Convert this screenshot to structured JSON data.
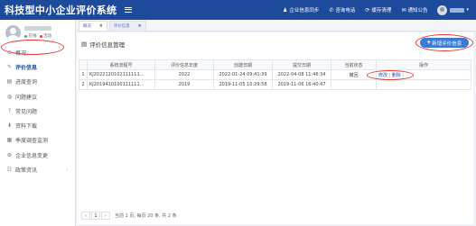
{
  "header": {
    "title": "科技型中小企业评价系统",
    "links": [
      {
        "icon": "user-icon",
        "glyph": "♟",
        "label": "企业信息同步"
      },
      {
        "icon": "phone-icon",
        "glyph": "✆",
        "label": "咨询电话"
      },
      {
        "icon": "refresh-icon",
        "glyph": "⟳",
        "label": "缓存清理"
      },
      {
        "icon": "mail-icon",
        "glyph": "✉",
        "label": "通知公告"
      }
    ],
    "caret": "▾"
  },
  "profile": {
    "online_label": "在线",
    "status_label": "活动",
    "online_color": "#4caf50",
    "status_color": "#e53935"
  },
  "sidebar": {
    "items": [
      {
        "label": "概况",
        "glyph": "⊙",
        "icon": "overview-icon"
      },
      {
        "label": "评价信息",
        "glyph": "✎",
        "icon": "edit-icon",
        "active": true
      },
      {
        "label": "进度查询",
        "glyph": "▤",
        "icon": "progress-icon"
      },
      {
        "label": "问题建议",
        "glyph": "◍",
        "icon": "suggestion-icon"
      },
      {
        "label": "常见问题",
        "glyph": "?",
        "icon": "question-icon"
      },
      {
        "label": "资料下载",
        "glyph": "⬇",
        "icon": "download-icon"
      },
      {
        "label": "季度调查监测",
        "glyph": "▦",
        "icon": "survey-icon"
      },
      {
        "label": "企业信息变更",
        "glyph": "⚙",
        "icon": "settings-icon"
      },
      {
        "label": "政策资讯",
        "glyph": "☷",
        "icon": "news-icon",
        "has_arrow": true
      }
    ],
    "arrow": "‹"
  },
  "tabs": [
    {
      "label": "概况",
      "close": "✖"
    },
    {
      "label": "评价信息",
      "close": "✖",
      "active": true
    }
  ],
  "panel": {
    "icon_glyph": "▤",
    "title": "评价信息管理",
    "new_button": {
      "plus": "+",
      "label": "新增评价信息"
    }
  },
  "table": {
    "headers": [
      "",
      "系统流程号",
      "评价信息年度",
      "创建日期",
      "提交日期",
      "当前状态",
      "操作"
    ],
    "rows": [
      {
        "index": "1",
        "flow_no": "KJ2022120102111111...",
        "year": "2022",
        "created": "2022-01-24 09:41:39",
        "submitted": "2022-04-08 11:46:34",
        "status": "撤回",
        "op_edit": "修改",
        "op_sep": "|",
        "op_delete": "删除",
        "op_sep2": "|"
      },
      {
        "index": "2",
        "flow_no": "KJ2019410100111111...",
        "year": "2019",
        "created": "2019-11-05 10:29:58",
        "submitted": "2019-11-06 16:40:47",
        "status": "",
        "op_edit": "",
        "op_sep": "",
        "op_delete": "",
        "op_sep2": ""
      }
    ]
  },
  "pager": {
    "prev": "‹",
    "current": "1",
    "next": "›",
    "info": "当前 1 页, 每页 20 条, 共 2 条"
  },
  "colors": {
    "header_bg": "#1e4a9c",
    "accent": "#3a7bd5",
    "highlight_ring": "#e53935"
  }
}
